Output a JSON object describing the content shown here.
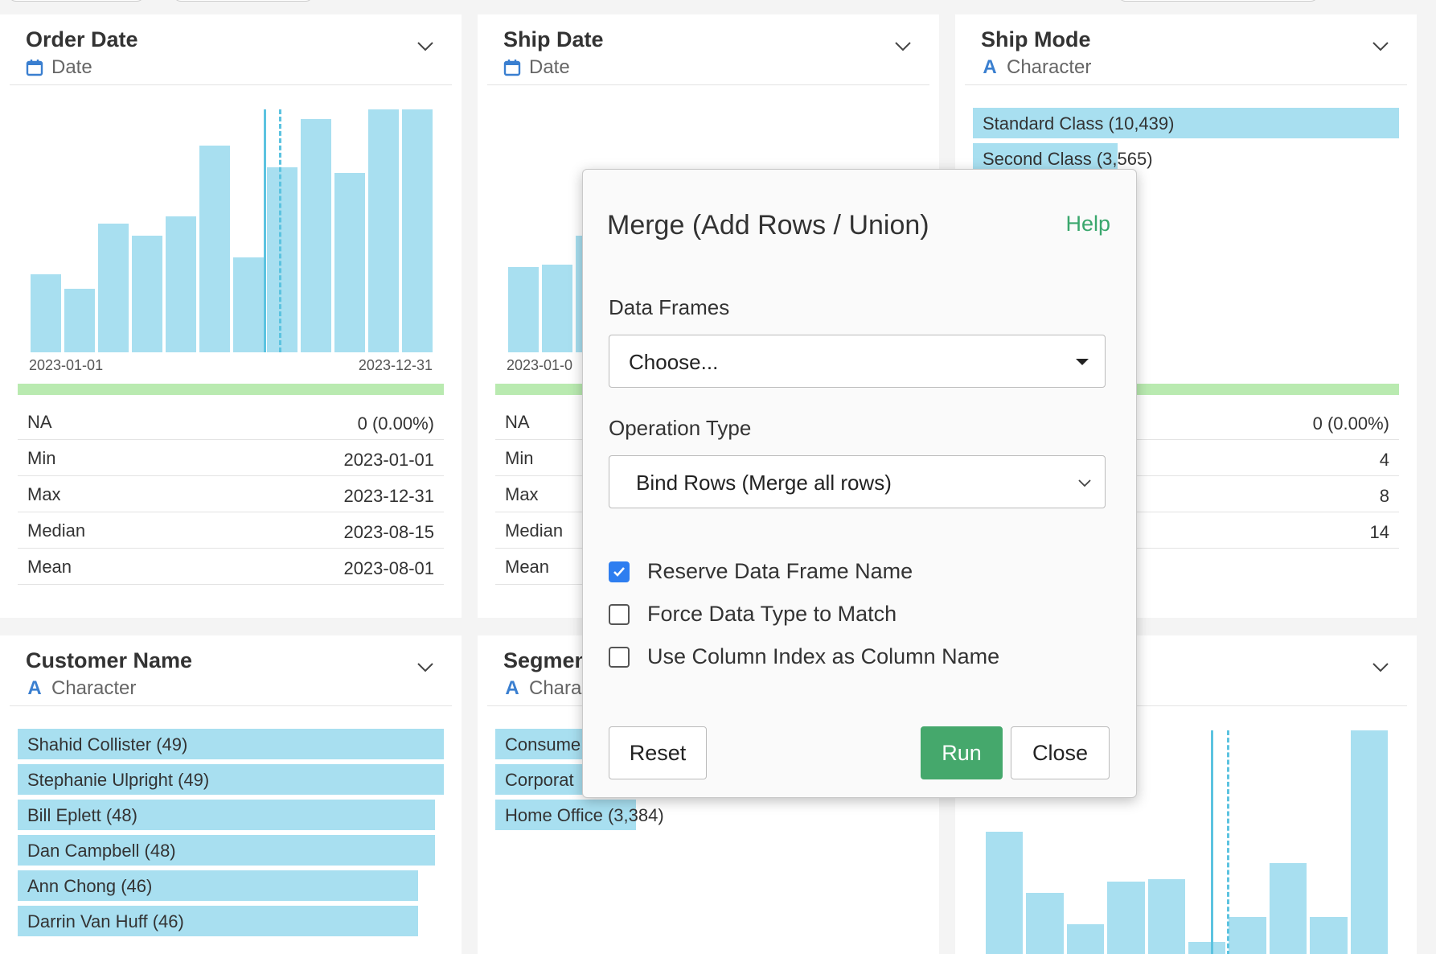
{
  "cards": {
    "order_date": {
      "title": "Order Date",
      "type": "Date",
      "x_start": "2023-01-01",
      "x_end": "2023-12-31",
      "stats": [
        {
          "k": "NA",
          "v": "0 (0.00%)"
        },
        {
          "k": "Min",
          "v": "2023-01-01"
        },
        {
          "k": "Max",
          "v": "2023-12-31"
        },
        {
          "k": "Median",
          "v": "2023-08-15"
        },
        {
          "k": "Mean",
          "v": "2023-08-01"
        }
      ]
    },
    "ship_date": {
      "title": "Ship Date",
      "type": "Date",
      "x_start": "2023-01-0",
      "stats": [
        {
          "k": "NA"
        },
        {
          "k": "Min"
        },
        {
          "k": "Max"
        },
        {
          "k": "Median"
        },
        {
          "k": "Mean"
        }
      ]
    },
    "ship_mode": {
      "title": "Ship Mode",
      "type": "Character",
      "categories": [
        {
          "label": "Standard Class (10,439)",
          "fraction": 1.0
        },
        {
          "label": "Second Class (3,565)",
          "fraction": 0.34
        }
      ],
      "stats": [
        {
          "v": "0 (0.00%)"
        },
        {
          "v": "4"
        },
        {
          "v": "8"
        },
        {
          "v": "14"
        }
      ]
    },
    "customer_name": {
      "title": "Customer Name",
      "type": "Character",
      "categories": [
        {
          "label": "Shahid Collister (49)",
          "fraction": 1.0
        },
        {
          "label": "Stephanie Ulpright (49)",
          "fraction": 1.0
        },
        {
          "label": "Bill Eplett (48)",
          "fraction": 0.98
        },
        {
          "label": "Dan Campbell (48)",
          "fraction": 0.98
        },
        {
          "label": "Ann Chong (46)",
          "fraction": 0.94
        },
        {
          "label": "Darrin Van Huff (46)",
          "fraction": 0.94
        }
      ]
    },
    "segment": {
      "title": "Segmen",
      "type": "Chara",
      "categories": [
        {
          "label": "Consume",
          "fraction": 1.0
        },
        {
          "label": "Corporat",
          "fraction": 0.6
        },
        {
          "label": "Home Office (3,384)",
          "fraction": 0.35
        }
      ]
    }
  },
  "icons": {
    "date_icon": "calendar-icon",
    "char_icon": "A",
    "chevron": "chevron-down-icon"
  },
  "modal": {
    "title": "Merge (Add Rows / Union)",
    "help": "Help",
    "data_frames_label": "Data Frames",
    "data_frames_value": "Choose...",
    "operation_type_label": "Operation Type",
    "operation_type_value": "Bind Rows (Merge all rows)",
    "checkboxes": [
      {
        "label": "Reserve Data Frame Name",
        "checked": true
      },
      {
        "label": "Force Data Type to Match",
        "checked": false
      },
      {
        "label": "Use Column Index as Column Name",
        "checked": false
      }
    ],
    "reset_label": "Reset",
    "run_label": "Run",
    "close_label": "Close"
  },
  "colors": {
    "bar": "#a8dff0",
    "na_bar": "#b9eab0",
    "run_button": "#45a86c",
    "help_link": "#3aa76d",
    "checkbox_on": "#2e7ef0"
  },
  "chart_data": [
    {
      "type": "bar",
      "title": "Order Date",
      "x": [
        "2023-01",
        "2023-02",
        "2023-03",
        "2023-04",
        "2023-05",
        "2023-06",
        "2023-07",
        "2023-08",
        "2023-09",
        "2023-10",
        "2023-11",
        "2023-12"
      ],
      "values": [
        0.32,
        0.26,
        0.53,
        0.48,
        0.56,
        0.85,
        0.39,
        0.76,
        0.96,
        0.74,
        1.0,
        1.0
      ],
      "median_marker": "2023-08-15",
      "mean_marker": "2023-08-01"
    },
    {
      "type": "bar",
      "title": "Ship Date",
      "values": [
        0.35,
        0.36,
        0.48
      ]
    },
    {
      "type": "bar",
      "title": "",
      "values": [
        0.55,
        0.28,
        0.14,
        0.33,
        0.34,
        0.06,
        0.17,
        0.41,
        0.17,
        1.0
      ]
    }
  ]
}
